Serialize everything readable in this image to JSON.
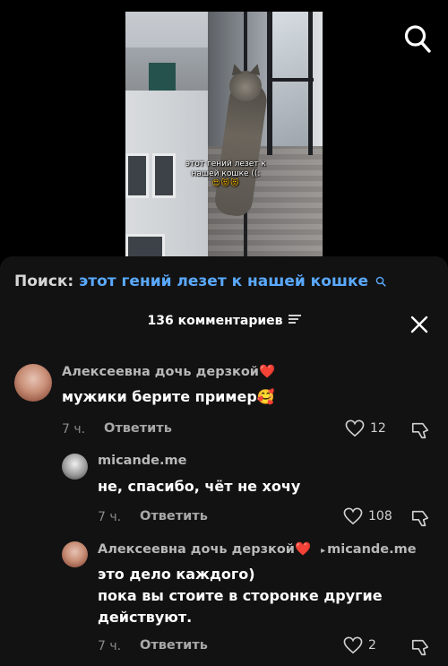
{
  "video": {
    "caption_line1": "этот гений лезет к",
    "caption_line2": "нашей кошке ((:",
    "caption_emoji": "😍😻😻"
  },
  "top_bar": {
    "search_icon": "search-icon"
  },
  "search": {
    "prefix": "Поиск:",
    "query": "этот гений лезет к нашей кошке"
  },
  "comments_header": {
    "count_label": "136 комментариев",
    "filter_icon": "filter-lines-icon",
    "close_icon": "close-icon"
  },
  "comments": [
    {
      "username": "Алексеевна дочь дерзкой",
      "username_emoji": "❤️",
      "text": "мужики берите пример",
      "text_emoji": "🥰",
      "time": "7 ч.",
      "reply_label": "Ответить",
      "likes": "12"
    },
    {
      "username": "micande.me",
      "text": "не, спасибо, чёт не хочу",
      "time": "7 ч.",
      "reply_label": "Ответить",
      "likes": "108"
    },
    {
      "username": "Алексеевна дочь дерзкой",
      "username_emoji": "❤️",
      "reply_to": "micande.me",
      "text_line1": "это дело каждого)",
      "text_line2": "пока вы стоите в сторонке другие",
      "text_line3": "действуют.",
      "time": "7 ч.",
      "reply_label": "Ответить",
      "likes": "2"
    }
  ],
  "colors": {
    "sheet_bg": "#121212",
    "search_link": "#5aa9ff",
    "heart": "#ff2d3d"
  }
}
